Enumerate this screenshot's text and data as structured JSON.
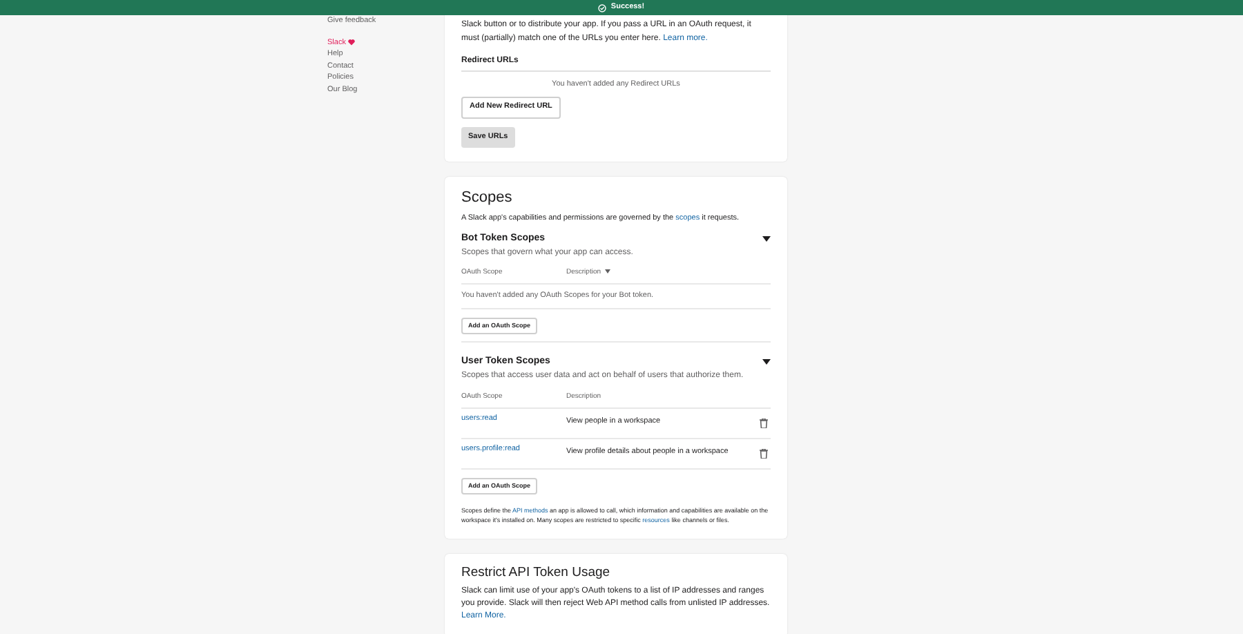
{
  "banner": {
    "text": "Success!"
  },
  "sidebar": {
    "top_link": "Give feedback",
    "brand": "Slack",
    "links": [
      "Help",
      "Contact",
      "Policies",
      "Our Blog"
    ]
  },
  "redirect_card": {
    "intro": "Slack button or to distribute your app. If you pass a URL in an OAuth request, it must (partially) match one of the URLs you enter here.",
    "intro_link": "Learn more.",
    "heading": "Redirect URLs",
    "empty": "You haven't added any Redirect URLs",
    "add_button": "Add New Redirect URL",
    "save_button": "Save URLs"
  },
  "scopes_card": {
    "title": "Scopes",
    "intro_before": "A Slack app's capabilities and permissions are governed by the",
    "intro_link": "scopes",
    "intro_after": "it requests.",
    "sections": [
      {
        "title": "Bot Token Scopes",
        "subtitle": "Scopes that govern what your app can access.",
        "expanded": true,
        "columns": [
          "OAuth Scope",
          "Description"
        ],
        "empty": "You haven't added any OAuth Scopes for your Bot token.",
        "add_button": "Add an OAuth Scope"
      },
      {
        "title": "User Token Scopes",
        "subtitle": "Scopes that access user data and act on behalf of users that authorize them.",
        "expanded": true,
        "columns": [
          "OAuth Scope",
          "Description"
        ],
        "rows": [
          {
            "scope": "users:read",
            "description": "View people in a workspace"
          },
          {
            "scope": "users.profile:read",
            "description": "View profile details about people in a workspace"
          }
        ],
        "add_button": "Add an OAuth Scope"
      }
    ],
    "footer_parts": [
      "Scopes define the ",
      "API methods",
      " an app is allowed to call, which information and capabilities are available on the workspace it's installed on. Many scopes are restricted to specific ",
      "resources",
      " like channels or files."
    ]
  },
  "restrict_card": {
    "title": "Restrict API Token Usage",
    "text": "Slack can limit use of your app's OAuth tokens to a list of IP addresses and ranges you provide. Slack will then reject Web API method calls from unlisted IP addresses.",
    "link": "Learn More."
  }
}
